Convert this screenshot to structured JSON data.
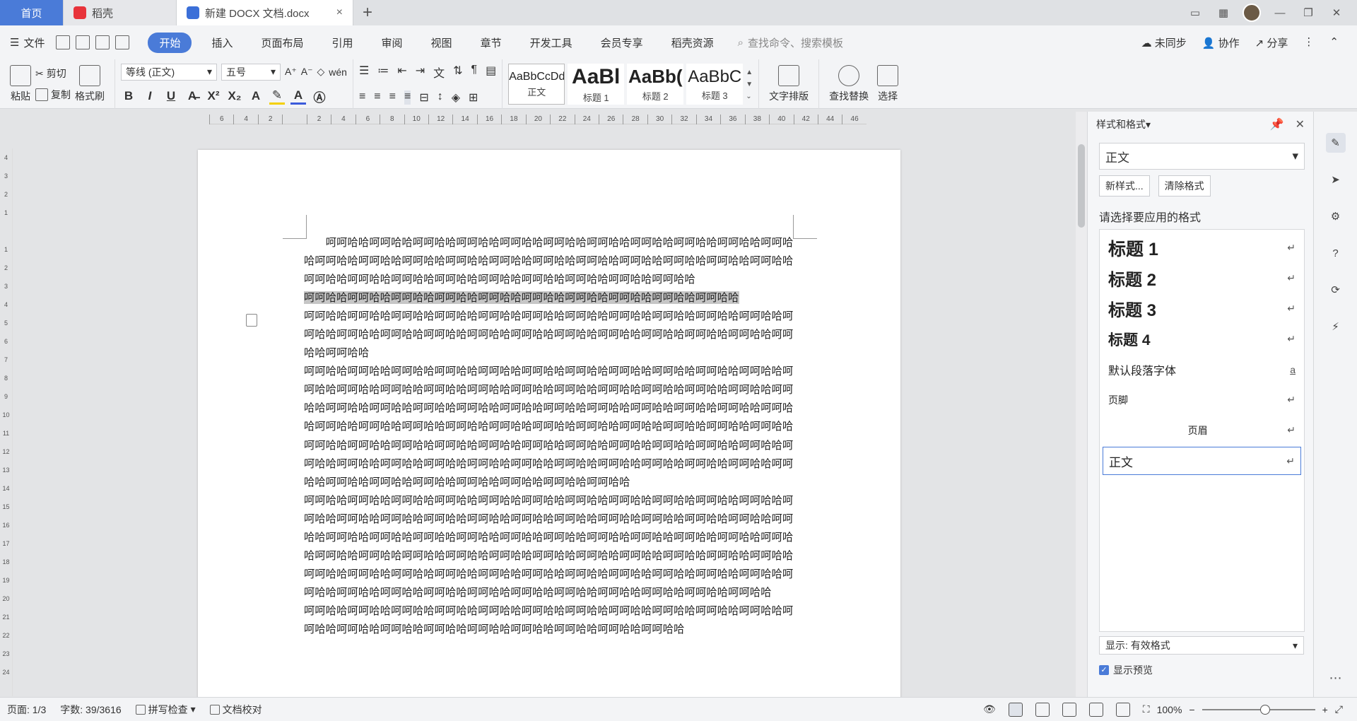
{
  "tabs": {
    "home": "首页",
    "daoke": "稻壳",
    "doc": "新建 DOCX 文档.docx"
  },
  "menubar": {
    "file": "文件",
    "tabs": [
      "开始",
      "插入",
      "页面布局",
      "引用",
      "审阅",
      "视图",
      "章节",
      "开发工具",
      "会员专享",
      "稻壳资源"
    ],
    "search": "查找命令、搜索模板",
    "sync": "未同步",
    "collab": "协作",
    "share": "分享"
  },
  "ribbon": {
    "paste": "粘贴",
    "cut": "剪切",
    "copy": "复制",
    "format_painter": "格式刷",
    "font": "等线 (正文)",
    "size": "五号",
    "styles": [
      {
        "preview": "AaBbCcDd",
        "name": "正文"
      },
      {
        "preview": "AaBl",
        "name": "标题 1"
      },
      {
        "preview": "AaBb(",
        "name": "标题 2"
      },
      {
        "preview": "AaBbC",
        "name": "标题 3"
      }
    ],
    "text_layout": "文字排版",
    "find_replace": "查找替换",
    "select": "选择"
  },
  "doc": {
    "paragraphs": [
      {
        "text": "　　呵呵哈哈呵呵哈哈呵呵哈哈呵呵哈哈呵呵哈哈呵呵哈哈呵呵哈哈呵呵哈哈呵呵哈哈呵呵哈哈呵呵哈哈呵呵哈哈呵呵哈哈呵呵哈哈呵呵哈哈呵呵哈哈呵呵哈哈呵呵哈哈呵呵哈哈呵呵哈哈呵呵哈哈呵呵哈哈呵呵哈哈呵呵哈哈呵呵哈哈呵呵哈哈呵呵哈哈呵呵哈哈呵呵哈哈呵呵哈哈呵呵哈哈",
        "highlight": false
      },
      {
        "text": "呵呵哈哈呵呵哈哈呵呵哈哈呵呵哈哈呵呵哈哈呵呵哈哈呵呵哈哈呵呵哈哈呵呵哈哈呵呵哈哈",
        "highlight": true
      },
      {
        "text": "呵呵哈哈呵呵哈哈呵呵哈哈呵呵哈哈呵呵哈哈呵呵哈哈呵呵哈哈呵呵哈哈呵呵哈哈呵呵哈哈呵呵哈哈呵呵哈哈呵呵哈哈呵呵哈哈呵呵哈哈呵呵哈哈呵呵哈哈呵呵哈哈呵呵哈哈呵呵哈哈呵呵哈哈呵呵哈哈呵呵哈哈呵呵哈哈",
        "highlight": false
      },
      {
        "text": "呵呵哈哈呵呵哈哈呵呵哈哈呵呵哈哈呵呵哈哈呵呵哈哈呵呵哈哈呵呵哈哈呵呵哈哈呵呵哈哈呵呵哈哈呵呵哈哈呵呵哈哈呵呵哈哈呵呵哈哈呵呵哈哈呵呵哈哈呵呵哈哈呵呵哈哈呵呵哈哈呵呵哈哈呵呵哈哈呵呵哈哈呵呵哈哈呵呵哈哈呵呵哈哈呵呵哈哈呵呵哈哈呵呵哈哈呵呵哈哈呵呵哈哈呵呵哈哈呵呵哈哈呵呵哈哈呵呵哈哈呵呵哈哈呵呵哈哈呵呵哈哈呵呵哈哈呵呵哈哈呵呵哈哈呵呵哈哈呵呵哈哈呵呵哈哈呵呵哈哈呵呵哈哈呵呵哈哈呵呵哈哈呵呵哈哈呵呵哈哈呵呵哈哈呵呵哈哈呵呵哈哈呵呵哈哈呵呵哈哈呵呵哈哈呵呵哈哈呵呵哈哈呵呵哈哈呵呵哈哈呵呵哈哈呵呵哈哈呵呵哈哈呵呵哈哈呵呵哈哈呵呵哈哈呵呵哈哈呵呵哈哈呵呵哈哈呵呵哈哈呵呵哈哈呵呵哈哈呵呵哈哈呵呵哈哈呵呵哈哈",
        "highlight": false
      },
      {
        "text": "呵呵哈哈呵呵哈哈呵呵哈哈呵呵哈哈呵呵哈哈呵呵哈哈呵呵哈哈呵呵哈哈呵呵哈哈呵呵哈哈呵呵哈哈呵呵哈哈呵呵哈哈呵呵哈哈呵呵哈哈呵呵哈哈呵呵哈哈呵呵哈哈呵呵哈哈呵呵哈哈呵呵哈哈呵呵哈哈呵呵哈哈呵呵哈哈呵呵哈哈呵呵哈哈呵呵哈哈呵呵哈哈呵呵哈哈呵呵哈哈呵呵哈哈呵呵哈哈呵呵哈哈呵呵哈哈呵呵哈哈呵呵哈哈呵呵哈哈呵呵哈哈呵呵哈哈呵呵哈哈呵呵哈哈呵呵哈哈呵呵哈哈呵呵哈哈呵呵哈哈呵呵哈哈呵呵哈哈呵呵哈哈呵呵哈哈呵呵哈哈呵呵哈哈呵呵哈哈呵呵哈哈呵呵哈哈呵呵哈哈呵呵哈哈呵呵哈哈呵呵哈哈呵呵哈哈呵呵哈哈呵呵哈哈呵呵哈哈呵呵哈哈呵呵哈哈呵呵哈哈呵呵哈哈呵呵哈哈",
        "highlight": false
      },
      {
        "text": "呵呵哈哈呵呵哈哈呵呵哈哈呵呵哈哈呵呵哈哈呵呵哈哈呵呵哈哈呵呵哈哈呵呵哈哈呵呵哈哈呵呵哈哈呵呵哈哈呵呵哈哈呵呵哈哈呵呵哈哈呵呵哈哈呵呵哈哈呵呵哈哈呵呵哈哈呵呵哈哈",
        "highlight": false
      }
    ]
  },
  "panel": {
    "title": "样式和格式",
    "current": "正文",
    "new_style": "新样式...",
    "clear": "清除格式",
    "prompt": "请选择要应用的格式",
    "styles": [
      "标题 1",
      "标题 2",
      "标题 3",
      "标题 4",
      "默认段落字体",
      "页脚",
      "页眉",
      "正文"
    ],
    "default_para_mark": "a",
    "return_mark": "↵",
    "show_label": "显示: 有效格式",
    "preview_label": "显示预览"
  },
  "status": {
    "page": "页面: 1/3",
    "words": "字数: 39/3616",
    "spell": "拼写检查",
    "proof": "文档校对",
    "zoom": "100%"
  }
}
